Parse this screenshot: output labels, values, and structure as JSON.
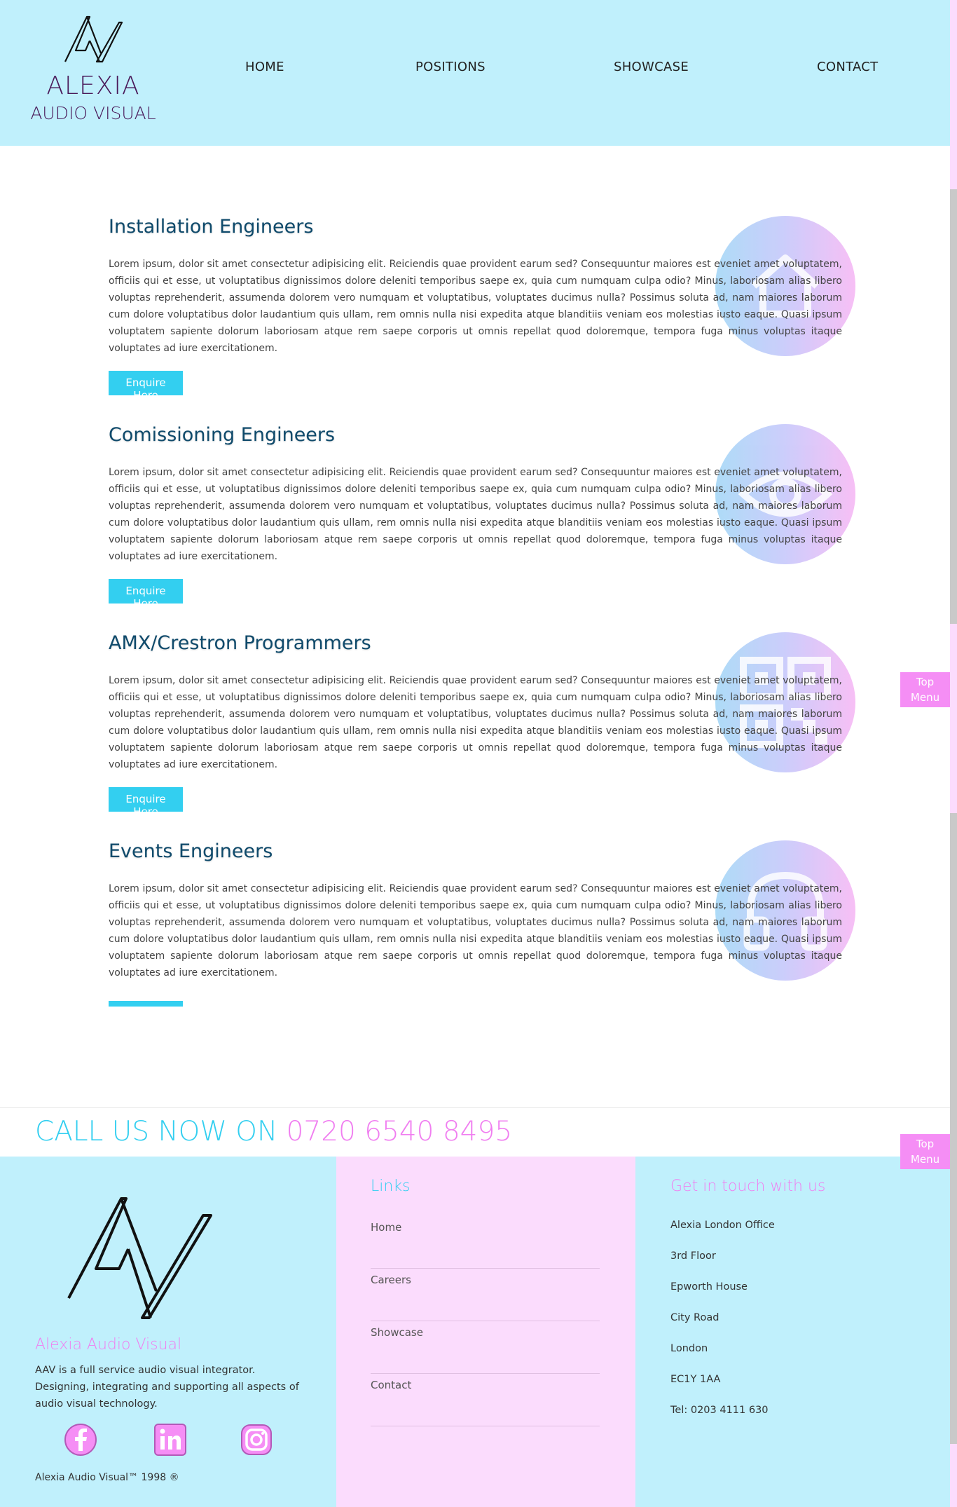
{
  "header": {
    "brand_name": "ALEXIA",
    "brand_sub": "AUDIO VISUAL",
    "nav": [
      "HOME",
      "POSITIONS",
      "SHOWCASE",
      "CONTACT"
    ]
  },
  "positions": [
    {
      "title": "Installation Engineers",
      "body": "Lorem ipsum, dolor sit amet consectetur adipisicing elit. Reiciendis quae provident earum sed? Consequuntur maiores est eveniet amet voluptatem, officiis qui et esse, ut voluptatibus dignissimos dolore deleniti temporibus saepe ex, quia cum numquam culpa odio? Minus, laboriosam alias libero voluptas reprehenderit, assumenda dolorem vero numquam et voluptatibus, voluptates ducimus nulla? Possimus soluta ad, nam maiores laborum cum dolore voluptatibus dolor laudantium quis ullam, rem omnis nulla nisi expedita atque blanditiis veniam eos molestias iusto eaque. Quasi ipsum voluptatem sapiente dolorum laboriosam atque rem saepe corporis ut omnis repellat quod doloremque, tempora fuga minus voluptas itaque voluptates ad iure exercitationem.",
      "button": "Enquire Here",
      "icon": "house-icon"
    },
    {
      "title": "Comissioning Engineers",
      "body": "Lorem ipsum, dolor sit amet consectetur adipisicing elit. Reiciendis quae provident earum sed? Consequuntur maiores est eveniet amet voluptatem, officiis qui et esse, ut voluptatibus dignissimos dolore deleniti temporibus saepe ex, quia cum numquam culpa odio? Minus, laboriosam alias libero voluptas reprehenderit, assumenda dolorem vero numquam et voluptatibus, voluptates ducimus nulla? Possimus soluta ad, nam maiores laborum cum dolore voluptatibus dolor laudantium quis ullam, rem omnis nulla nisi expedita atque blanditiis veniam eos molestias iusto eaque. Quasi ipsum voluptatem sapiente dolorum laboriosam atque rem saepe corporis ut omnis repellat quod doloremque, tempora fuga minus voluptas itaque voluptates ad iure exercitationem.",
      "button": "Enquire Here",
      "icon": "eye-icon"
    },
    {
      "title": "AMX/Crestron Programmers",
      "body": "Lorem ipsum, dolor sit amet consectetur adipisicing elit. Reiciendis quae provident earum sed? Consequuntur maiores est eveniet amet voluptatem, officiis qui et esse, ut voluptatibus dignissimos dolore deleniti temporibus saepe ex, quia cum numquam culpa odio? Minus, laboriosam alias libero voluptas reprehenderit, assumenda dolorem vero numquam et voluptatibus, voluptates ducimus nulla? Possimus soluta ad, nam maiores laborum cum dolore voluptatibus dolor laudantium quis ullam, rem omnis nulla nisi expedita atque blanditiis veniam eos molestias iusto eaque. Quasi ipsum voluptatem sapiente dolorum laboriosam atque rem saepe corporis ut omnis repellat quod doloremque, tempora fuga minus voluptas itaque voluptates ad iure exercitationem.",
      "button": "Enquire Here",
      "icon": "qr-code-icon"
    },
    {
      "title": "Events Engineers",
      "body": "Lorem ipsum, dolor sit amet consectetur adipisicing elit. Reiciendis quae provident earum sed? Consequuntur maiores est eveniet amet voluptatem, officiis qui et esse, ut voluptatibus dignissimos dolore deleniti temporibus saepe ex, quia cum numquam culpa odio? Minus, laboriosam alias libero voluptas reprehenderit, assumenda dolorem vero numquam et voluptatibus, voluptates ducimus nulla? Possimus soluta ad, nam maiores laborum cum dolore voluptatibus dolor laudantium quis ullam, rem omnis nulla nisi expedita atque blanditiis veniam eos molestias iusto eaque. Quasi ipsum voluptatem sapiente dolorum laboriosam atque rem saepe corporis ut omnis repellat quod doloremque, tempora fuga minus voluptas itaque voluptates ad iure exercitationem.",
      "button": "",
      "icon": "headphones-icon"
    }
  ],
  "call": {
    "lead": "CALL US NOW ON ",
    "number": "0720 6540 8495"
  },
  "top_menu": {
    "line1": "Top",
    "line2": "Menu"
  },
  "footer": {
    "brand": "Alexia Audio Visual",
    "description": "AAV is a full service audio visual integrator. Designing, integrating and supporting all aspects of audio visual technology.",
    "copyright": "Alexia Audio Visual™ 1998 ®",
    "social": [
      "facebook-icon",
      "linkedin-icon",
      "instagram-icon"
    ],
    "links_heading": "Links",
    "links": [
      "Home",
      "Careers",
      "Showcase",
      "Contact"
    ],
    "contact_heading": "Get in touch with us",
    "address": [
      "Alexia London Office",
      "3rd Floor",
      "Epworth House",
      "City Road",
      "London",
      "EC1Y 1AA",
      "Tel: 0203 4111 630"
    ]
  },
  "colors": {
    "header_bg": "#c0f0fc",
    "accent_cyan": "#33cff0",
    "accent_pink": "#f07ef0",
    "footer_pink": "#fbdcfd",
    "title_blue": "#0f4a6b"
  }
}
